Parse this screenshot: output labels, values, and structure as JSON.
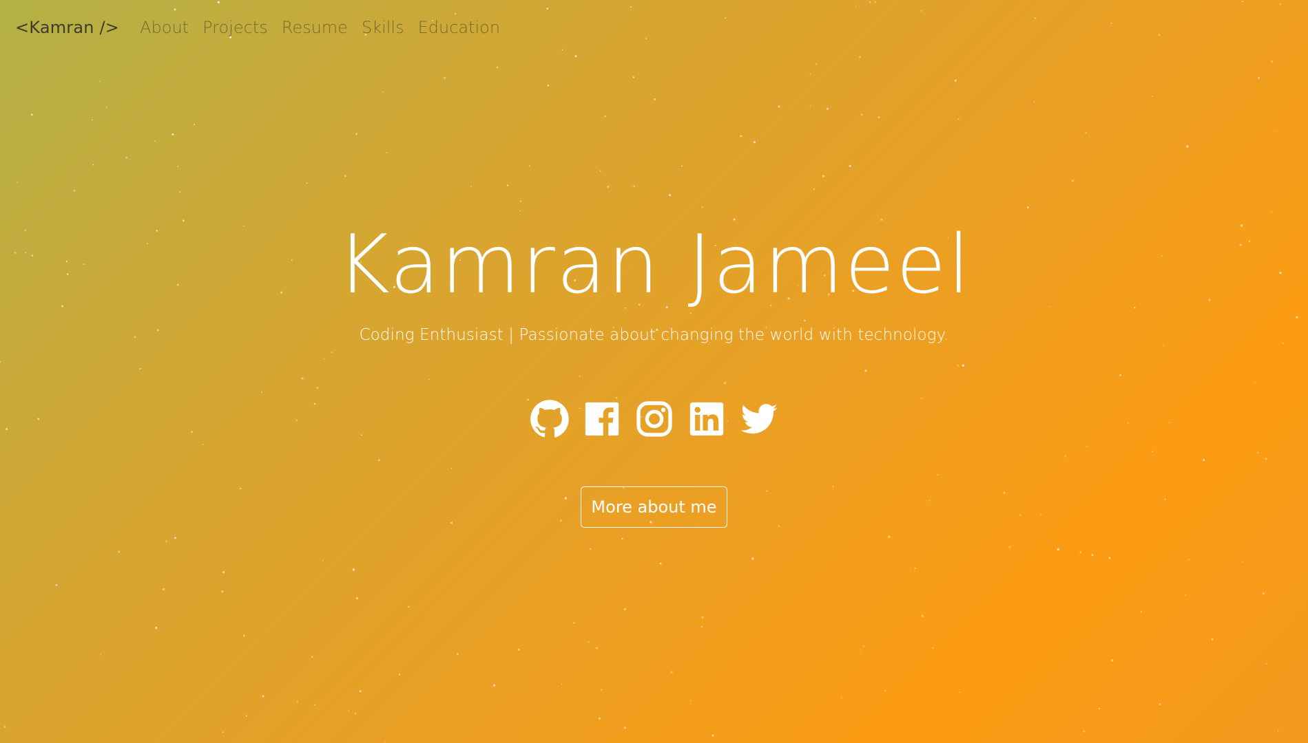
{
  "nav": {
    "brand": "<Kamran />",
    "links": [
      "About",
      "Projects",
      "Resume",
      "Skills",
      "Education"
    ]
  },
  "hero": {
    "name": "Kamran Jameel",
    "tagline": "Coding Enthusiast | Passionate about changing the world with technology.",
    "socials": [
      {
        "icon": "github-icon"
      },
      {
        "icon": "facebook-icon"
      },
      {
        "icon": "instagram-icon"
      },
      {
        "icon": "linkedin-icon"
      },
      {
        "icon": "twitter-icon"
      }
    ],
    "cta_label": "More about me"
  },
  "colors": {
    "gradient_start": "#b3b146",
    "gradient_end": "#fd9c13",
    "text": "#ffffff",
    "nav_text": "#3d3b2c"
  }
}
